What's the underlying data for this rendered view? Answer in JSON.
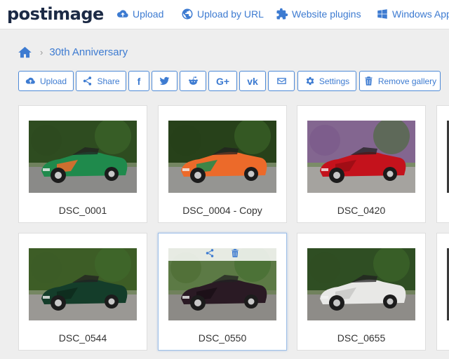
{
  "header": {
    "logo_text": "postimage",
    "nav": [
      {
        "label": "Upload",
        "icon": "cloud-upload-icon"
      },
      {
        "label": "Upload by URL",
        "icon": "globe-icon"
      },
      {
        "label": "Website plugins",
        "icon": "puzzle-icon"
      },
      {
        "label": "Windows App",
        "icon": "windows-icon"
      }
    ]
  },
  "breadcrumb": {
    "home_icon": "home-icon",
    "current": "30th Anniversary"
  },
  "toolbar": {
    "upload_label": "Upload",
    "share_label": "Share",
    "facebook_glyph": "f",
    "googleplus_glyph": "G+",
    "vk_glyph": "vk",
    "settings_label": "Settings",
    "remove_label": "Remove gallery"
  },
  "gallery": {
    "items": [
      {
        "title": "DSC_0001",
        "car_color": "#1f8a4c",
        "accent": "#ec6a2a"
      },
      {
        "title": "DSC_0004 - Copy",
        "car_color": "#ec6a2a",
        "accent": "#1f8a4c"
      },
      {
        "title": "DSC_0420",
        "car_color": "#c4121c",
        "accent": "#9b0d14"
      },
      {
        "title": "DSC_0544",
        "car_color": "#143d2a",
        "accent": "#0d2a1c"
      },
      {
        "title": "DSC_0550",
        "car_color": "#2a1a24",
        "accent": "#1a0f16"
      },
      {
        "title": "DSC_0655",
        "car_color": "#e8e8e6",
        "accent": "#c8c8c6"
      }
    ]
  },
  "colors": {
    "accent": "#3d7bd1",
    "background": "#eeeeee"
  }
}
